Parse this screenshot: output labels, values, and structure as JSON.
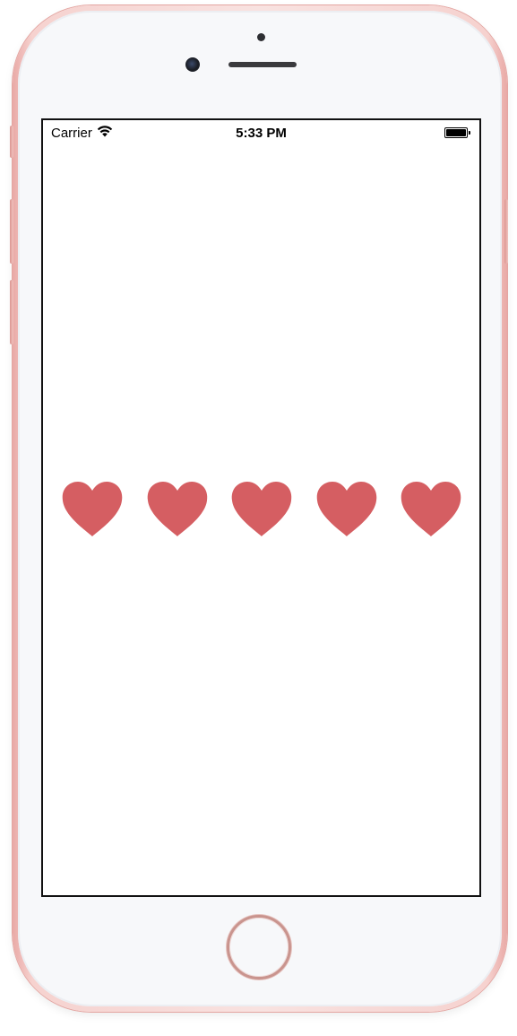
{
  "status_bar": {
    "carrier": "Carrier",
    "wifi_icon": "wifi-icon",
    "time": "5:33 PM",
    "battery_icon": "battery-icon",
    "battery_level": 1.0
  },
  "rating": {
    "max": 5,
    "value": 5,
    "icon": "heart-icon",
    "color": "#d55e62"
  },
  "device": {
    "frame_color": "#f3c7c3",
    "home_button_icon": "home-button"
  }
}
